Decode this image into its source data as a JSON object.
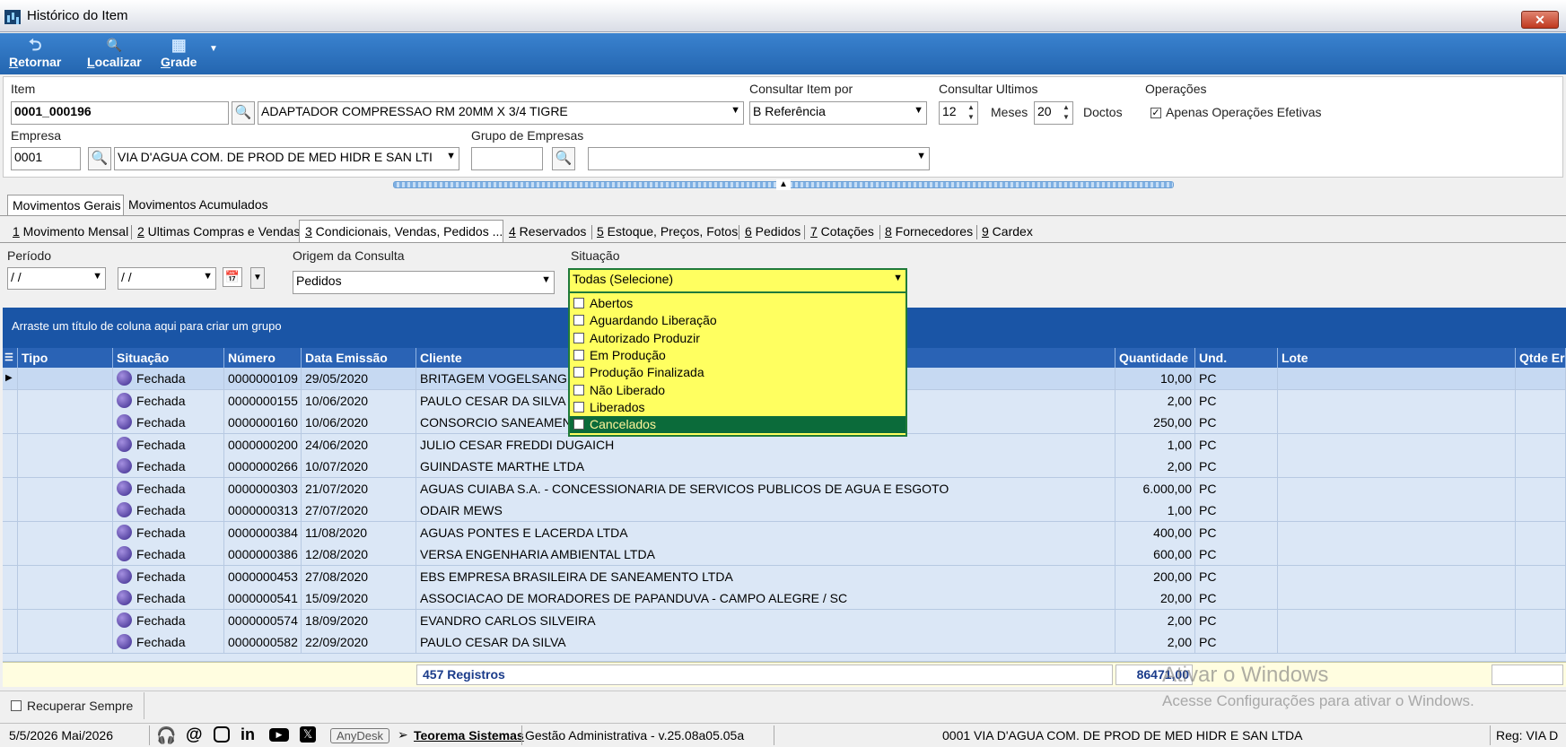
{
  "window": {
    "title": "Histórico do Item",
    "close_label": "✕"
  },
  "toolbar": [
    {
      "label": "Retornar",
      "key": "R",
      "rest": "etornar",
      "icon": "undo-icon",
      "glyph": "⮌"
    },
    {
      "label": "Localizar",
      "key": "L",
      "rest": "ocalizar",
      "icon": "search-icon",
      "glyph": "🔍"
    },
    {
      "label": "Grade",
      "key": "G",
      "rest": "rade",
      "icon": "grid-icon",
      "glyph": "▦"
    }
  ],
  "header": {
    "item_label": "Item",
    "item_code": "0001_000196",
    "item_desc": "ADAPTADOR COMPRESSAO RM 20MM X 3/4 TIGRE",
    "consultar_por_label": "Consultar Item por",
    "consultar_por_value": "B Referência",
    "consultar_ultimos_label": "Consultar Ultimos",
    "meses_value": "12",
    "meses_label": "Meses",
    "doctos_value": "20",
    "doctos_label": "Doctos",
    "operacoes_label": "Operações",
    "apenas_label": "Apenas Operações Efetivas",
    "apenas_checked": "✓",
    "empresa_label": "Empresa",
    "empresa_code": "0001",
    "empresa_name": "VIA D'AGUA COM. DE PROD DE MED HIDR E SAN LTI",
    "grupo_label": "Grupo de Empresas",
    "grupo_code": "",
    "grupo_name": ""
  },
  "tabs_main": [
    "Movimentos Gerais",
    "Movimentos Acumulados"
  ],
  "tabs_sub": [
    {
      "key": "1",
      "label": " Movimento Mensal"
    },
    {
      "key": "2",
      "label": " Ultimas Compras e Vendas"
    },
    {
      "key": "3",
      "label": " Condicionais, Vendas, Pedidos ..."
    },
    {
      "key": "4",
      "label": " Reservados"
    },
    {
      "key": "5",
      "label": " Estoque, Preços, Fotos"
    },
    {
      "key": "6",
      "label": " Pedidos"
    },
    {
      "key": "7",
      "label": " Cotações"
    },
    {
      "key": "8",
      "label": " Fornecedores"
    },
    {
      "key": "9",
      "label": " Cardex"
    }
  ],
  "filters": {
    "periodo_label": "Período",
    "date_from": " /  /",
    "date_to": " /  /",
    "origem_label": "Origem da Consulta",
    "origem_value": "Pedidos",
    "situacao_label": "Situação",
    "situacao_value": "Todas (Selecione)"
  },
  "dropdown_items": [
    "Abertos",
    "Aguardando Liberação",
    "Autorizado Produzir",
    "Em Produção",
    "Produção Finalizada",
    "Não Liberado",
    "Liberados",
    "Cancelados"
  ],
  "group_band_text": "Arraste um título de coluna aqui para criar um grupo",
  "columns": [
    "Tipo",
    "Situação",
    "Número",
    "Data Emissão",
    "Cliente",
    "Quantidade",
    "Und.",
    "Lote",
    "Qtde Er"
  ],
  "rows": [
    {
      "situacao": "Fechada",
      "numero": "0000000109",
      "data": "29/05/2020",
      "cliente": "BRITAGEM VOGELSANGER",
      "qtd": "10,00",
      "und": "PC"
    },
    {
      "situacao": "Fechada",
      "numero": "0000000155",
      "data": "10/06/2020",
      "cliente": "PAULO CESAR DA SILVA",
      "qtd": "2,00",
      "und": "PC"
    },
    {
      "situacao": "Fechada",
      "numero": "0000000160",
      "data": "10/06/2020",
      "cliente": "CONSORCIO SANEAMENTO",
      "qtd": "250,00",
      "und": "PC"
    },
    {
      "situacao": "Fechada",
      "numero": "0000000200",
      "data": "24/06/2020",
      "cliente": "JULIO CESAR FREDDI DUGAICH",
      "qtd": "1,00",
      "und": "PC"
    },
    {
      "situacao": "Fechada",
      "numero": "0000000266",
      "data": "10/07/2020",
      "cliente": "GUINDASTE MARTHE LTDA",
      "qtd": "2,00",
      "und": "PC"
    },
    {
      "situacao": "Fechada",
      "numero": "0000000303",
      "data": "21/07/2020",
      "cliente": "AGUAS CUIABA S.A. - CONCESSIONARIA DE SERVICOS PUBLICOS DE AGUA E ESGOTO",
      "qtd": "6.000,00",
      "und": "PC"
    },
    {
      "situacao": "Fechada",
      "numero": "0000000313",
      "data": "27/07/2020",
      "cliente": "ODAIR MEWS",
      "qtd": "1,00",
      "und": "PC"
    },
    {
      "situacao": "Fechada",
      "numero": "0000000384",
      "data": "11/08/2020",
      "cliente": "AGUAS PONTES E LACERDA LTDA",
      "qtd": "400,00",
      "und": "PC"
    },
    {
      "situacao": "Fechada",
      "numero": "0000000386",
      "data": "12/08/2020",
      "cliente": "VERSA ENGENHARIA AMBIENTAL LTDA",
      "qtd": "600,00",
      "und": "PC"
    },
    {
      "situacao": "Fechada",
      "numero": "0000000453",
      "data": "27/08/2020",
      "cliente": "EBS EMPRESA BRASILEIRA DE SANEAMENTO LTDA",
      "qtd": "200,00",
      "und": "PC"
    },
    {
      "situacao": "Fechada",
      "numero": "0000000541",
      "data": "15/09/2020",
      "cliente": "ASSOCIACAO DE MORADORES DE PAPANDUVA - CAMPO ALEGRE / SC",
      "qtd": "20,00",
      "und": "PC"
    },
    {
      "situacao": "Fechada",
      "numero": "0000000574",
      "data": "18/09/2020",
      "cliente": "EVANDRO CARLOS SILVEIRA",
      "qtd": "2,00",
      "und": "PC"
    },
    {
      "situacao": "Fechada",
      "numero": "0000000582",
      "data": "22/09/2020",
      "cliente": "PAULO CESAR DA SILVA",
      "qtd": "2,00",
      "und": "PC"
    }
  ],
  "footer": {
    "registros": "457 Registros",
    "total": "86471,00"
  },
  "recuperar_label": "Recuperar Sempre",
  "watermark": {
    "line1": "Ativar o Windows",
    "line2": "Acesse Configurações para ativar o Windows."
  },
  "status": {
    "date": "5/5/2026 Mai/2026",
    "anydesk": "AnyDesk",
    "company_link": "Teorema Sistemas",
    "version": "Gestão Administrativa - v.25.08a05.05a",
    "empresa": "0001 VIA D'AGUA COM. DE PROD DE MED HIDR E SAN LTDA",
    "reg": "Reg: VIA D"
  },
  "colors": {
    "selection_highlight": "#0b6b3a",
    "dropdown_bg": "#ffff60",
    "header_blue": "#2a63b5"
  }
}
